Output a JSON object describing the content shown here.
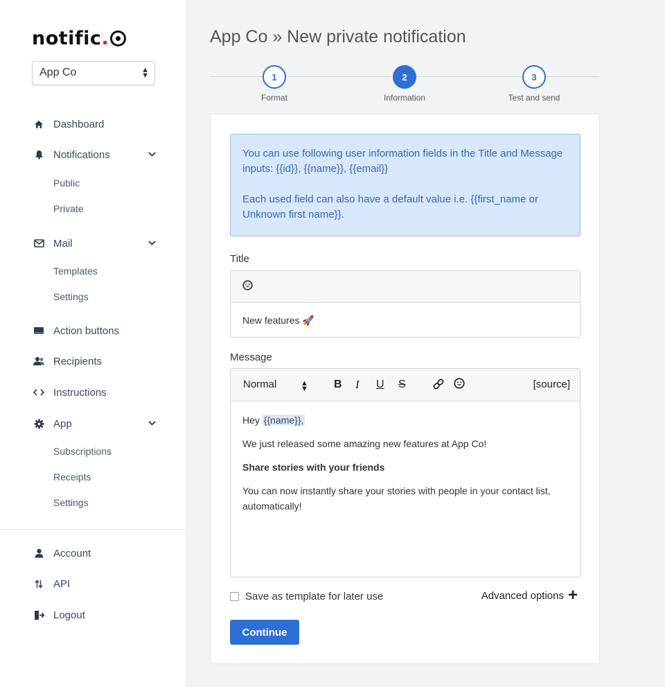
{
  "logo": {
    "text": "notific",
    "dot": "."
  },
  "app_select": {
    "value": "App Co"
  },
  "nav": {
    "dashboard": "Dashboard",
    "notifications": "Notifications",
    "public": "Public",
    "private": "Private",
    "mail": "Mail",
    "templates": "Templates",
    "mail_settings": "Settings",
    "action_buttons": "Action buttons",
    "recipients": "Recipients",
    "instructions": "Instructions",
    "app": "App",
    "subscriptions": "Subscriptions",
    "receipts": "Receipts",
    "app_settings": "Settings",
    "account": "Account",
    "api": "API",
    "logout": "Logout"
  },
  "header": {
    "title": "App Co » New private notification"
  },
  "steps": [
    {
      "number": "1",
      "label": "Format",
      "state": "done"
    },
    {
      "number": "2",
      "label": "Information",
      "state": "active"
    },
    {
      "number": "3",
      "label": "Test and send",
      "state": "pending"
    }
  ],
  "info": {
    "line1": "You can use following user information fields in the Title and Message inputs: {{id}}, {{name}}, {{email}}",
    "line2": "Each used field can also have a default value i.e. {{first_name or Unknown first name}}."
  },
  "title_field": {
    "label": "Title",
    "value": "New features 🚀"
  },
  "message_field": {
    "label": "Message",
    "toolbar": {
      "format": "Normal",
      "source": "[source]"
    },
    "greeting": "Hey ",
    "name_tag": "{{name}},",
    "para1": "We just released some amazing new features at App Co!",
    "heading": "Share stories with your friends",
    "para2": "You can now instantly share your stories with people in your contact list, automatically!"
  },
  "save_template_label": "Save as template for later use",
  "advanced_options_label": "Advanced options",
  "continue_label": "Continue",
  "colors": {
    "accent": "#2d6fd3",
    "info_bg": "#d9e7fb",
    "info_text": "#3566b5",
    "logo_dot": "#e2231a"
  }
}
